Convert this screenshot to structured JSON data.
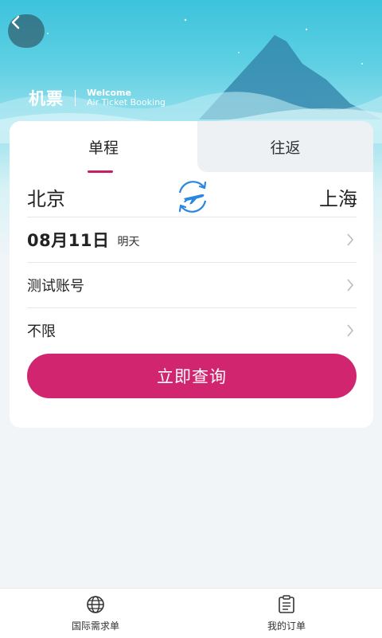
{
  "header": {
    "title": "机票",
    "subtitle_line1": "Welcome",
    "subtitle_line2": "Air Ticket Booking"
  },
  "tabs": [
    {
      "label": "单程",
      "active": true
    },
    {
      "label": "往返",
      "active": false
    }
  ],
  "route": {
    "from_city": "北京",
    "to_city": "上海"
  },
  "form": {
    "date_main": "08月11日",
    "date_sub": "明天",
    "passenger": "测试账号",
    "cabin": "不限"
  },
  "search_label": "立即查询",
  "bottom_nav": [
    {
      "label": "国际需求单",
      "icon": "globe-icon"
    },
    {
      "label": "我的订单",
      "icon": "document-icon"
    }
  ],
  "colors": {
    "accent": "#d2256f",
    "swap_icon": "#2a86e0"
  }
}
